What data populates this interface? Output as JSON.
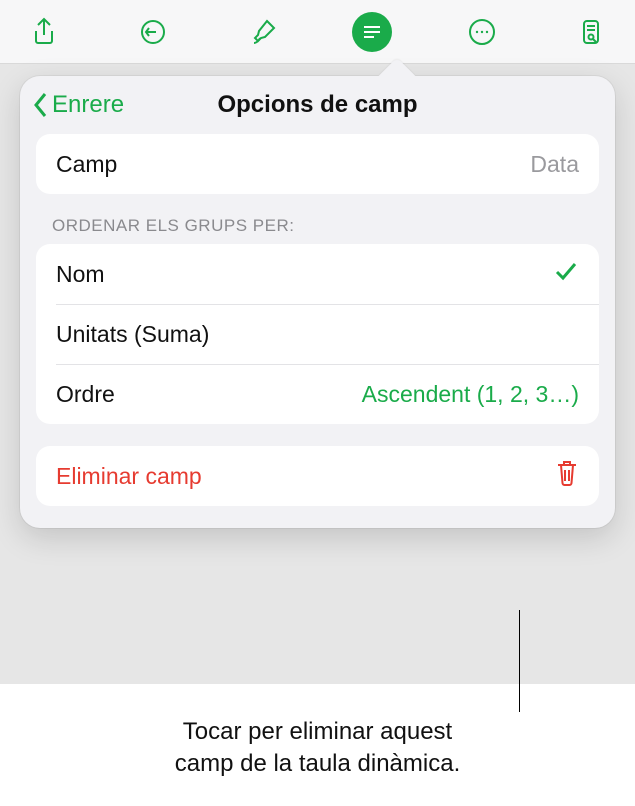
{
  "toolbar": {
    "icons": [
      "share-icon",
      "undo-icon",
      "format-brush-icon",
      "text-lines-icon",
      "more-icon",
      "document-view-icon"
    ]
  },
  "panel": {
    "back_label": "Enrere",
    "title": "Opcions de camp",
    "field": {
      "label": "Camp",
      "value": "Data"
    },
    "sort_section_label": "Ordenar els grups per:",
    "sort_options": [
      {
        "label": "Nom",
        "checked": true
      },
      {
        "label": "Unitats (Suma)",
        "checked": false
      }
    ],
    "order": {
      "label": "Ordre",
      "value": "Ascendent (1, 2, 3…)"
    },
    "delete_label": "Eliminar camp"
  },
  "caption": {
    "line1": "Tocar per eliminar aquest",
    "line2": "camp de la taula dinàmica."
  }
}
